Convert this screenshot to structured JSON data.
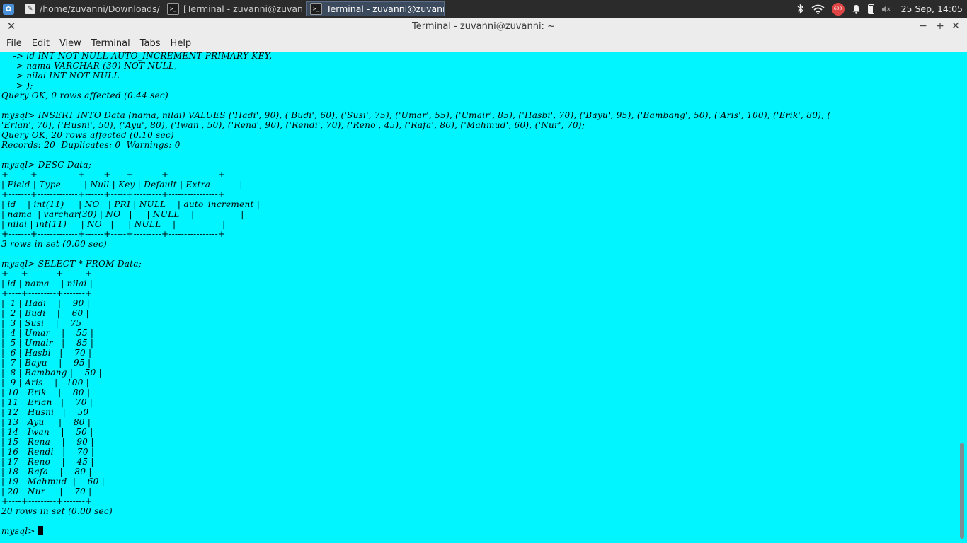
{
  "panel": {
    "tasks": [
      {
        "label": "/home/zuvanni/Downloads/T...",
        "icon": "text-editor-icon"
      },
      {
        "label": "[Terminal - zuvanni@zuvanni...",
        "icon": "terminal-icon"
      },
      {
        "label": "Terminal - zuvanni@zuvanni: ~",
        "icon": "terminal-icon"
      }
    ],
    "notification_badge": "600",
    "clock": "25 Sep, 14:05"
  },
  "window": {
    "title": "Terminal - zuvanni@zuvanni: ~"
  },
  "menu": [
    "File",
    "Edit",
    "View",
    "Terminal",
    "Tabs",
    "Help"
  ],
  "terminal": {
    "lines": [
      "    -> id INT NOT NULL AUTO_INCREMENT PRIMARY KEY,",
      "    -> nama VARCHAR (30) NOT NULL,",
      "    -> nilai INT NOT NULL",
      "    -> );",
      "Query OK, 0 rows affected (0.44 sec)",
      "",
      "mysql> INSERT INTO Data (nama, nilai) VALUES ('Hadi', 90), ('Budi', 60), ('Susi', 75), ('Umar', 55), ('Umair', 85), ('Hasbi', 70), ('Bayu', 95), ('Bambang', 50), ('Aris', 100), ('Erik', 80), (",
      "'Erlan', 70), ('Husni', 50), ('Ayu', 80), ('Iwan', 50), ('Rena', 90), ('Rendi', 70), ('Reno', 45), ('Rafa', 80), ('Mahmud', 60), ('Nur', 70);",
      "Query OK, 20 rows affected (0.10 sec)",
      "Records: 20  Duplicates: 0  Warnings: 0",
      "",
      "mysql> DESC Data;",
      "+-------+-------------+------+-----+---------+----------------+",
      "| Field | Type        | Null | Key | Default | Extra          |",
      "+-------+-------------+------+-----+---------+----------------+",
      "| id    | int(11)     | NO   | PRI | NULL    | auto_increment |",
      "| nama  | varchar(30) | NO   |     | NULL    |                |",
      "| nilai | int(11)     | NO   |     | NULL    |                |",
      "+-------+-------------+------+-----+---------+----------------+",
      "3 rows in set (0.00 sec)",
      "",
      "mysql> SELECT * FROM Data;",
      "+----+---------+-------+",
      "| id | nama    | nilai |",
      "+----+---------+-------+",
      "|  1 | Hadi    |    90 |",
      "|  2 | Budi    |    60 |",
      "|  3 | Susi    |    75 |",
      "|  4 | Umar    |    55 |",
      "|  5 | Umair   |    85 |",
      "|  6 | Hasbi   |    70 |",
      "|  7 | Bayu    |    95 |",
      "|  8 | Bambang |    50 |",
      "|  9 | Aris    |   100 |",
      "| 10 | Erik    |    80 |",
      "| 11 | Erlan   |    70 |",
      "| 12 | Husni   |    50 |",
      "| 13 | Ayu     |    80 |",
      "| 14 | Iwan    |    50 |",
      "| 15 | Rena    |    90 |",
      "| 16 | Rendi   |    70 |",
      "| 17 | Reno    |    45 |",
      "| 18 | Rafa    |    80 |",
      "| 19 | Mahmud  |    60 |",
      "| 20 | Nur     |    70 |",
      "+----+---------+-------+",
      "20 rows in set (0.00 sec)",
      "",
      "mysql> "
    ],
    "background": "#00f5ff",
    "foreground": "#000000"
  }
}
